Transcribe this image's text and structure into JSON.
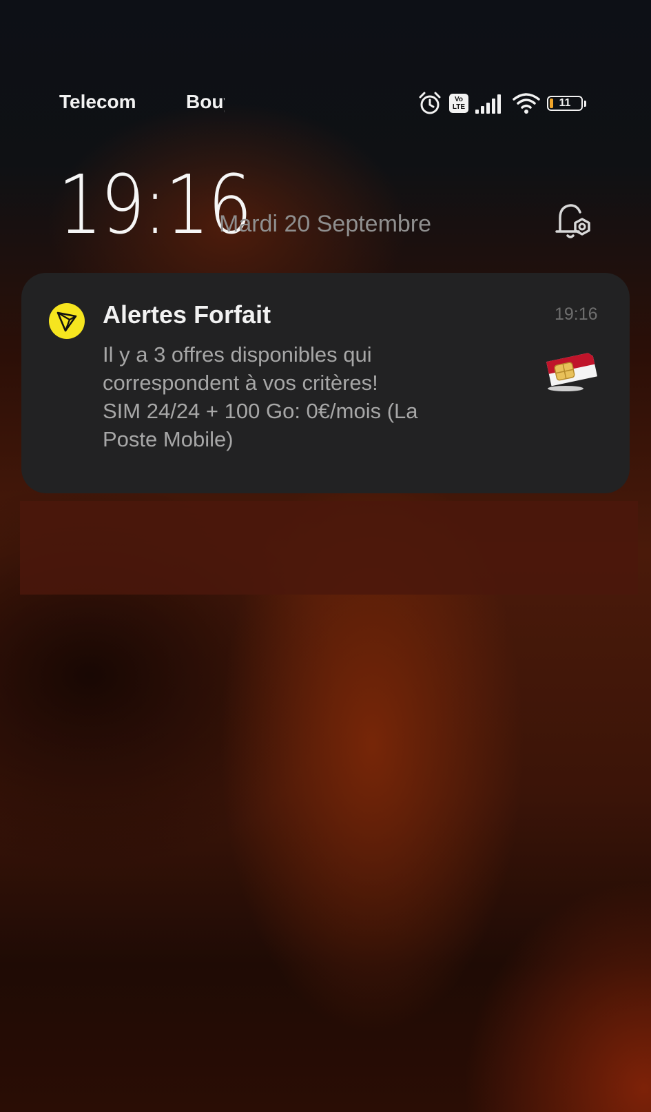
{
  "status_bar": {
    "carrier_1": "Telecom",
    "carrier_2": "Bouygues",
    "icons": [
      "alarm-icon",
      "volte-icon",
      "signal-icon",
      "wifi-icon",
      "battery-icon"
    ],
    "volte_top": "Vo",
    "volte_bottom": "LTE",
    "battery_level": "11",
    "battery_fraction": 0.11
  },
  "lockscreen": {
    "time": "19:16",
    "date": "Mardi 20 Septembre",
    "settings_icon": "notification-settings-icon"
  },
  "notification": {
    "app_icon": "tron-logo-icon",
    "app_icon_color": "#f6e51f",
    "title": "Alertes Forfait",
    "time": "19:16",
    "body_lines": [
      "Il y a 3 offres disponibles qui",
      "correspondent à vos critères!",
      "SIM 24/24 + 100 Go: 0€/mois (La",
      "Poste Mobile)"
    ],
    "thumbnail": "sim-card-icon"
  },
  "colors": {
    "card_background": "#222223",
    "battery_fill": "#f1a52a",
    "accent_red": "#c0142a"
  }
}
